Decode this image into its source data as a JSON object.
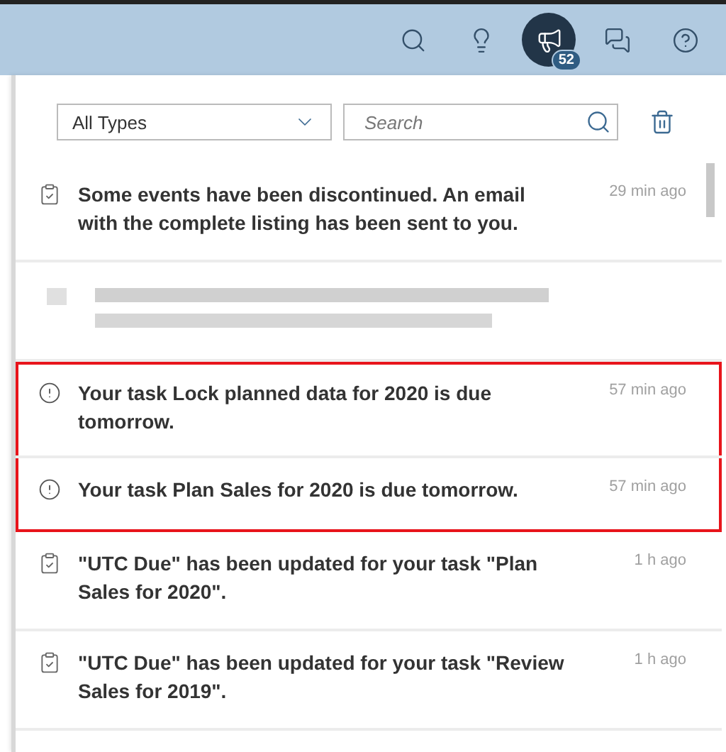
{
  "shell_bar": {
    "actions": [
      {
        "kind": "search",
        "selected": false
      },
      {
        "kind": "ideas",
        "selected": false
      },
      {
        "kind": "notifications",
        "selected": true,
        "badge": "52"
      },
      {
        "kind": "chat",
        "selected": false
      },
      {
        "kind": "help",
        "selected": false
      }
    ]
  },
  "filter": {
    "type_select": "All Types",
    "search": {
      "placeholder": "Search"
    }
  },
  "notifications": [
    {
      "kind": "task",
      "text": "Some events have been discontinued. An email with the complete listing has been sent to you.",
      "time": "29 min ago",
      "highlighted": false
    },
    {
      "kind": "redacted",
      "highlighted": false
    },
    {
      "kind": "alert",
      "text": "Your task Lock planned data for 2020 is due tomorrow.",
      "time": "57 min ago",
      "highlighted": true
    },
    {
      "kind": "alert",
      "text": "Your task Plan Sales for 2020 is due tomorrow.",
      "time": "57 min ago",
      "highlighted": true
    },
    {
      "kind": "task",
      "text": "\"UTC Due\" has been updated for your task \"Plan Sales for 2020\".",
      "time": "1 h ago",
      "highlighted": false
    },
    {
      "kind": "task",
      "text": "\"UTC Due\" has been updated for your task \"Review Sales for 2019\".",
      "time": "1 h ago",
      "highlighted": false
    }
  ]
}
